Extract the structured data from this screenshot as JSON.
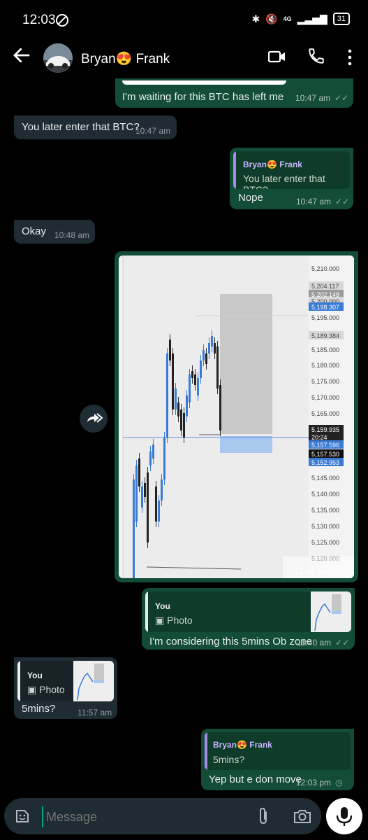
{
  "status_bar": {
    "time": "12:03",
    "network": "4G",
    "battery": "31"
  },
  "header": {
    "contact_name": "Bryan😍 Frank"
  },
  "messages": {
    "m1": {
      "text": "I'm waiting for this BTC has left me",
      "time": "10:47 am"
    },
    "m2": {
      "text": "You later enter that BTC?",
      "time": "10:47 am"
    },
    "m3": {
      "quote_name": "Bryan😍 Frank",
      "quote_text": "You later enter that BTC?",
      "text": "Nope",
      "time": "10:47 am"
    },
    "m4": {
      "text": "Okay",
      "time": "10:48 am"
    },
    "m5": {
      "time": "11:40 am"
    },
    "m6": {
      "quote_name": "You",
      "quote_text": "Photo",
      "text": "I'm considering this 5mins Ob zone",
      "time": "11:40 am"
    },
    "m7": {
      "quote_name": "You",
      "quote_text": "Photo",
      "text": "5mins?",
      "time": "11:57 am"
    },
    "m8": {
      "quote_name": "Bryan😍 Frank",
      "quote_text": "5mins?",
      "text": "Yep but e don move",
      "time": "12:03 pm"
    }
  },
  "chart_image": {
    "price_labels": [
      "5,210.000",
      "5,204.117",
      "5,202.148",
      "5,200.000",
      "5,198.307",
      "5,195.000",
      "5,189.384",
      "5,185.000",
      "5,180.000",
      "5,175.000",
      "5,170.000",
      "5,165.000",
      "5,159.935",
      "20:24",
      "5,157.596",
      "5,157.530",
      "5,152.953",
      "5,145.000",
      "5,140.000",
      "5,135.000",
      "5,130.000",
      "5,125.000",
      "5,120.000"
    ]
  },
  "input": {
    "placeholder": "Message"
  },
  "colors": {
    "outgoing": "#144d37",
    "incoming": "#202c33",
    "accent": "#00a884",
    "candle_up": "#3a7bd5",
    "candle_down": "#222222"
  }
}
